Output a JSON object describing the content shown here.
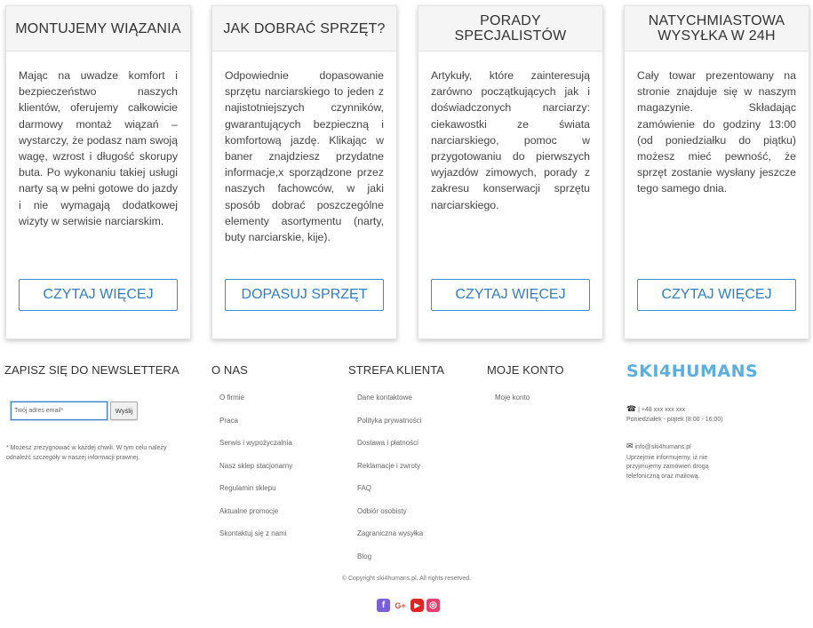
{
  "cards": [
    {
      "title": "MONTUJEMY WIĄZANIA",
      "body": "Mając na uwadze komfort i bezpieczeństwo naszych klientów, oferujemy całkowicie darmowy montaż wiązań – wystarczy, że podasz nam swoją wagę, wzrost i długość skorupy buta. Po wykonaniu takiej usługi narty są w pełni gotowe do jazdy i nie wymagają dodatkowej wizyty w serwisie narciarskim.",
      "button": "CZYTAJ WIĘCEJ"
    },
    {
      "title": "JAK DOBRAĆ SPRZĘT?",
      "body": "Odpowiednie dopasowanie sprzętu narciarskiego to jeden z najistotniejszych czynników, gwarantujących bezpieczną i komfortową jazdę. Klikając w baner znajdziesz przydatne informacje,x sporządzone przez naszych fachowców, w jaki sposób dobrać poszczególne elementy asortymentu (narty, buty narciarskie, kije).",
      "button": "DOPASUJ SPRZĘT"
    },
    {
      "title": "PORADY SPECJALISTÓW",
      "body": "Artykuły, które zainteresują zarówno początkujących jak i doświadczonych narciarzy: ciekawostki ze świata narciarskiego, pomoc w przygotowaniu do pierwszych wyjazdów zimowych, porady z zakresu konserwacji sprzętu narciarskiego.",
      "button": "CZYTAJ WIĘCEJ"
    },
    {
      "title": "NATYCHMIASTOWA WYSYŁKA W 24H",
      "body": "Cały towar prezentowany na stronie znajduje się w naszym magazynie. Składając zamówienie do godziny 13:00 (od poniedziałku do piątku) możesz mieć pewność, że sprzęt zostanie wysłany jeszcze tego samego dnia.",
      "button": "CZYTAJ WIĘCEJ"
    }
  ],
  "newsletter": {
    "title": "ZAPISZ SIĘ DO NEWSLETTERA",
    "placeholder": "Twój adres email*",
    "button": "Wyślij",
    "note": "* Możesz zrezygnować w każdej chwili. W tym celu należy odnaleźć szczegóły w naszej informacji prawnej."
  },
  "about": {
    "title": "O NAS",
    "links": [
      "O firmie",
      "Praca",
      "Serwis i wypożyczalnia",
      "Nasz sklep stacjonarny",
      "Regulamin sklepu",
      "Aktualne promocje",
      "Skontaktuj się z nami"
    ]
  },
  "client_zone": {
    "title": "STREFA KLIENTA",
    "links": [
      "Dane kontaktowe",
      "Polityka prywatności",
      "Dostawa i płatności",
      "Reklamacje i zwroty",
      "FAQ",
      "Odbiór osobisty",
      "Zagraniczna wysyłka",
      "Blog"
    ]
  },
  "account": {
    "title": "MOJE KONTO",
    "links": [
      "Moje konto"
    ]
  },
  "contact": {
    "logo": "SKI4HUMANS",
    "phone": "| +48 xxx xxx xxx",
    "hours": "Poniedziałek - piątek (8:00 - 16:00)",
    "email": "info@ski4humans.pl",
    "email_note": "Uprzejmie informujemy, iż nie przyjmujemy zamówień drogą telefoniczną oraz mailową."
  },
  "copyright": "© Copyright ski4humans.pl. All rights reserved.",
  "socials": [
    {
      "icon": "facebook-icon",
      "glyph": "f",
      "color": "#7b5fd6"
    },
    {
      "icon": "google-plus-icon",
      "glyph": "G+",
      "color": "#ffffff"
    },
    {
      "icon": "youtube-icon",
      "glyph": "▶",
      "color": "#e02424"
    },
    {
      "icon": "instagram-icon",
      "glyph": "◎",
      "color": "#e4406f"
    }
  ]
}
